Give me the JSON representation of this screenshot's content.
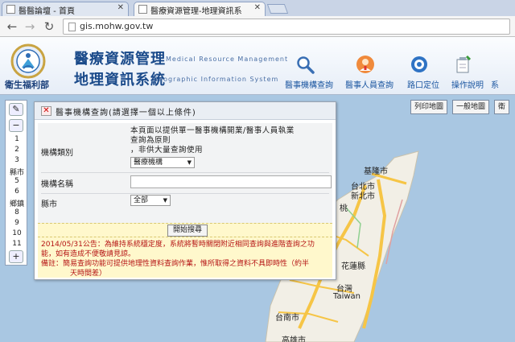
{
  "browser": {
    "tabs": [
      {
        "title": "醫醫論壇 - 首頁",
        "active": false
      },
      {
        "title": "醫療資源管理-地理資訊系",
        "active": true
      }
    ],
    "url": "gis.mohw.gov.tw"
  },
  "header": {
    "ministry": "衛生福利部",
    "title_zh_1": "醫療資源管理",
    "title_en_1": "Medical Resource Management",
    "title_zh_2": "地理資訊系統",
    "title_en_2": "Geographic Information System",
    "nav": [
      {
        "label": "醫事機構查詢",
        "icon": "magnifier-icon"
      },
      {
        "label": "醫事人員查詢",
        "icon": "medical-staff-icon"
      },
      {
        "label": "路口定位",
        "icon": "locate-icon"
      },
      {
        "label": "操作說明",
        "icon": "help-icon"
      },
      {
        "label": "系",
        "icon": "system-icon"
      }
    ]
  },
  "map": {
    "buttons": [
      "列印地圖",
      "一般地圖",
      "衛"
    ],
    "labels": [
      "基隆市",
      "台北市",
      "新北市",
      "桃",
      "花蓮縣",
      "台灣",
      "Taiwan",
      "台南市",
      "高雄市"
    ],
    "zoom_levels": [
      "1",
      "2",
      "3",
      "縣市",
      "5",
      "6",
      "鄉鎮",
      "8",
      "9",
      "10",
      "11"
    ]
  },
  "panel": {
    "title": "醫事機構查詢(請選擇一個以上條件)",
    "labels": {
      "type": "機構類別",
      "name": "機構名稱",
      "city": "縣市"
    },
    "description": [
      "本頁面以提供單一醫事機構開業/醫事人員執業",
      "查詢為原則",
      "，非供大量查詢使用"
    ],
    "type_select": "醫療機構",
    "name_value": "",
    "city_select": "全部",
    "search_button": "開始搜尋",
    "notice_lines": [
      "2014/05/31公告：為維持系統穩定度，系統將暫時關閉附近相同查詢與進階查詢之功",
      "能，如有造成不便敬請見諒。",
      "備註：簡易查詢功能可提供地理性資料查詢作業，惟所取得之資料不具即時性（約半",
      "天時間差）"
    ]
  },
  "colors": {
    "map_water": "#a9c7e2",
    "map_land": "#f2efe6",
    "road_major": "#f6c546",
    "panel_notice": "#b51414",
    "header_blue": "#1a4a8a"
  }
}
